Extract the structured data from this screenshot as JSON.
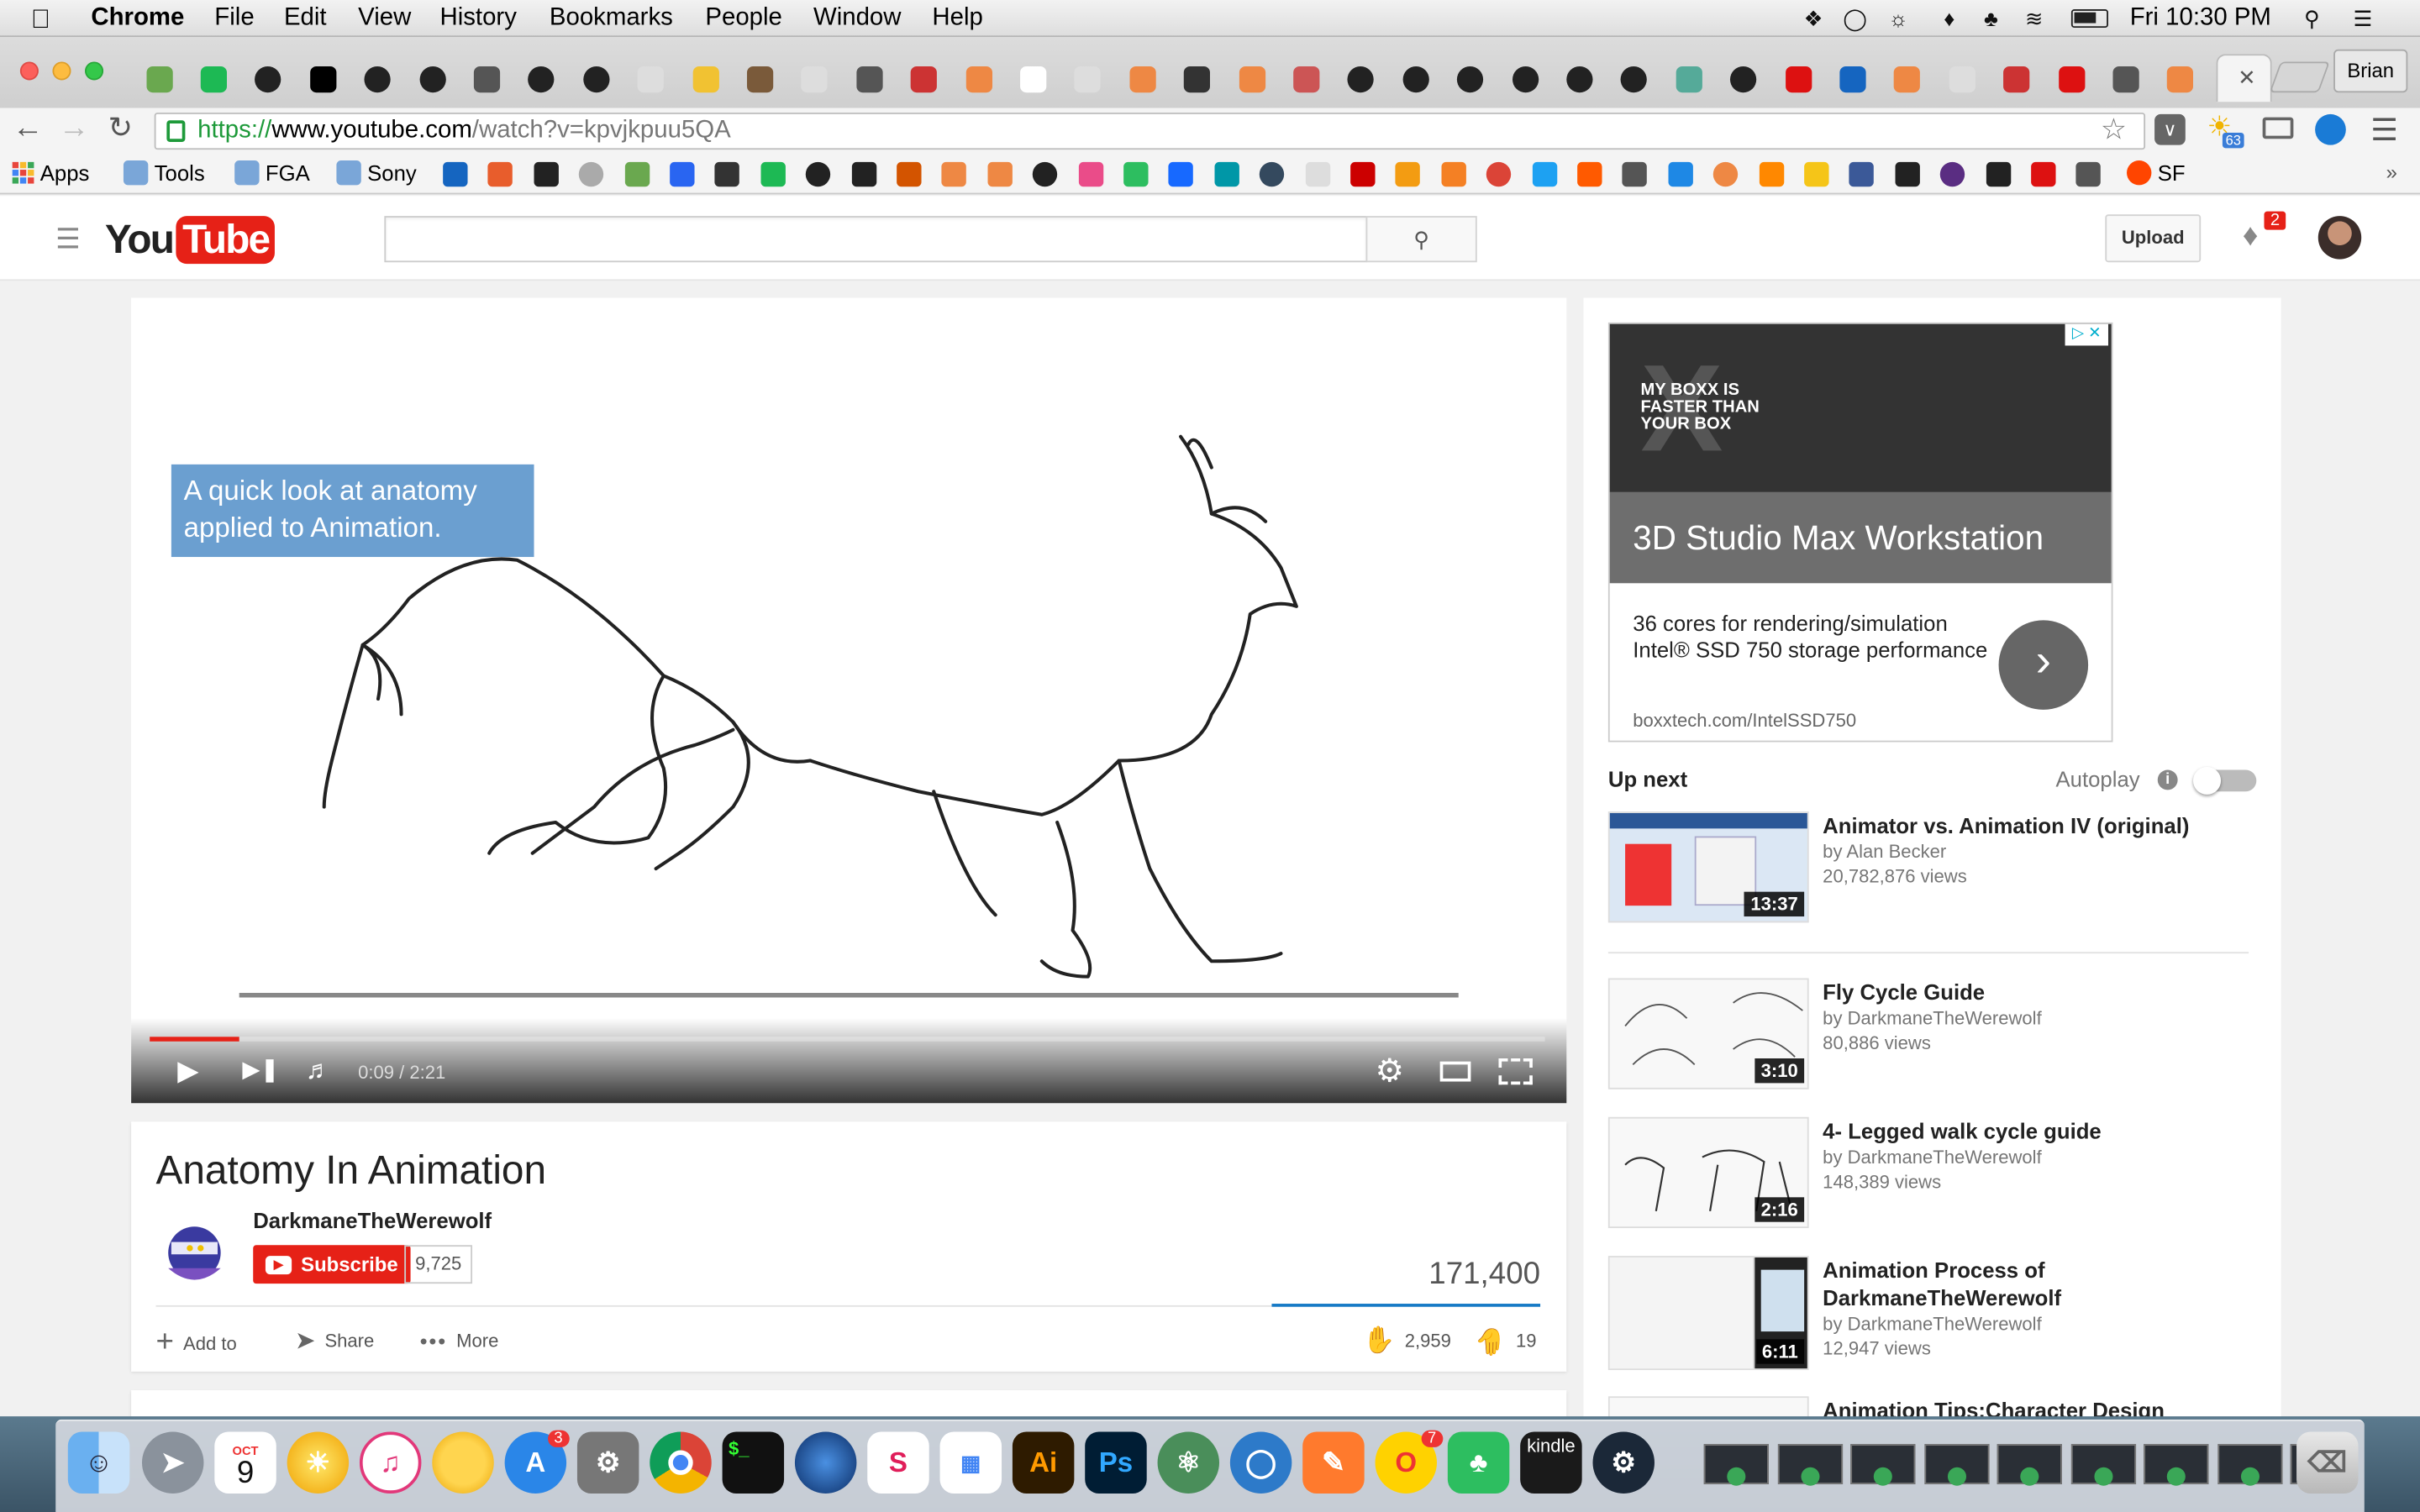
{
  "menubar": {
    "app": "Chrome",
    "items": [
      "File",
      "Edit",
      "View",
      "History",
      "Bookmarks",
      "People",
      "Window",
      "Help"
    ],
    "clock": "Fri 10:30 PM"
  },
  "browser": {
    "profile": "Brian",
    "url_prefix": "https://",
    "url_host": "www.youtube.com",
    "url_path": "/watch?v=kpvjkpuu5QA",
    "weather_badge": "63"
  },
  "bookmarks": {
    "apps": "Apps",
    "folders": [
      "Tools",
      "FGA",
      "Sony"
    ],
    "sf": "SF"
  },
  "youtube": {
    "logo_you": "You",
    "logo_tube": "Tube",
    "upload": "Upload",
    "notif_count": "2"
  },
  "video": {
    "annotation": "A quick look at anatomy applied to Animation.",
    "time": "0:09 / 2:21",
    "progress": 0.064,
    "title": "Anatomy In Animation",
    "channel": "DarkmaneTheWerewolf",
    "subscribe": "Subscribe",
    "subs": "9,725",
    "views": "171,400",
    "add_to": "Add to",
    "share": "Share",
    "more": "More",
    "likes": "2,959",
    "dislikes": "19"
  },
  "ad": {
    "banner": "MY BOXX IS FASTER THAN YOUR BOX",
    "title": "3D Studio Max Workstation",
    "body": "36 cores for rendering/simulation Intel® SSD 750 storage performance",
    "url": "boxxtech.com/IntelSSD750"
  },
  "sidebar": {
    "up_next": "Up next",
    "autoplay": "Autoplay",
    "videos": [
      {
        "title": "Animator vs. Animation IV (original)",
        "by": "by Alan Becker",
        "views": "20,782,876 views",
        "dur": "13:37"
      },
      {
        "title": "Fly Cycle Guide",
        "by": "by DarkmaneTheWerewolf",
        "views": "80,886 views",
        "dur": "3:10"
      },
      {
        "title": "4- Legged walk cycle guide",
        "by": "by DarkmaneTheWerewolf",
        "views": "148,389 views",
        "dur": "2:16"
      },
      {
        "title": "Animation Process of DarkmaneTheWerewolf",
        "by": "by DarkmaneTheWerewolf",
        "views": "12,947 views",
        "dur": "6:11"
      },
      {
        "title": "Animation Tips:Character Design",
        "by": "",
        "views": "",
        "dur": ""
      }
    ]
  },
  "dock": {
    "calendar_month": "OCT",
    "calendar_day": "9",
    "appstore_badge": "3",
    "opera_badge": "7",
    "kindle": "kindle",
    "ai": "Ai",
    "ps": "Ps"
  },
  "colors": {
    "yt_red": "#e62117",
    "ad_dark": "#333333",
    "ad_gray": "#6e6e6e",
    "link_blue": "#167ac6"
  }
}
